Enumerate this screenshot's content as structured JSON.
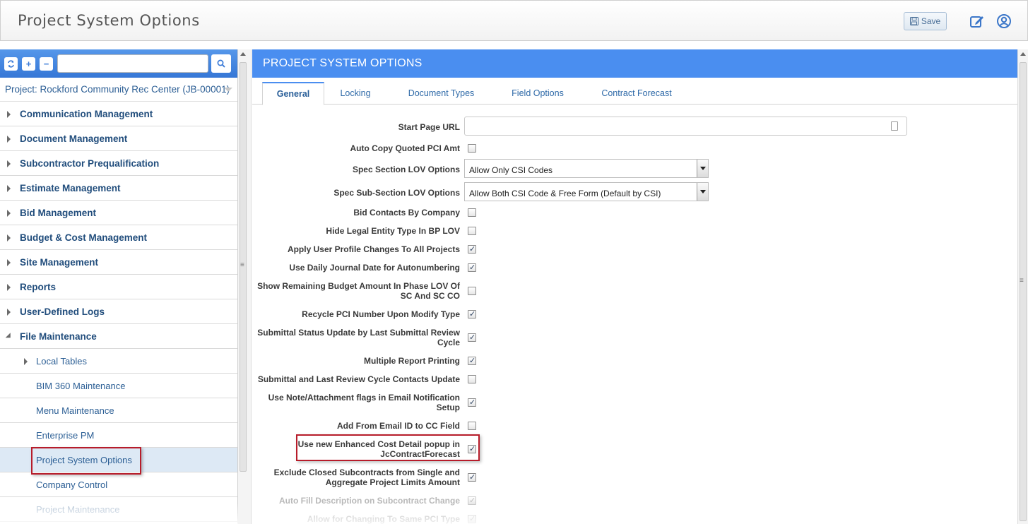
{
  "app": {
    "title": "Project System Options"
  },
  "toolbar": {
    "save_label": "Save"
  },
  "left": {
    "search_placeholder": "",
    "project_label": "Project: Rockford Community Rec Center (JB-00001)",
    "menu": [
      {
        "label": "Communication Management",
        "level": 0,
        "expanded": false
      },
      {
        "label": "Document Management",
        "level": 0,
        "expanded": false
      },
      {
        "label": "Subcontractor Prequalification",
        "level": 0,
        "expanded": false
      },
      {
        "label": "Estimate Management",
        "level": 0,
        "expanded": false
      },
      {
        "label": "Bid Management",
        "level": 0,
        "expanded": false
      },
      {
        "label": "Budget & Cost Management",
        "level": 0,
        "expanded": false
      },
      {
        "label": "Site Management",
        "level": 0,
        "expanded": false
      },
      {
        "label": "Reports",
        "level": 0,
        "expanded": false
      },
      {
        "label": "User-Defined Logs",
        "level": 0,
        "expanded": false
      },
      {
        "label": "File Maintenance",
        "level": 0,
        "expanded": true
      },
      {
        "label": "Local Tables",
        "level": 1,
        "expandable": true
      },
      {
        "label": "BIM 360 Maintenance",
        "level": 1
      },
      {
        "label": "Menu Maintenance",
        "level": 1
      },
      {
        "label": "Enterprise PM",
        "level": 1
      },
      {
        "label": "Project System Options",
        "level": 1,
        "selected": true
      },
      {
        "label": "Company Control",
        "level": 1
      },
      {
        "label": "Project Maintenance",
        "level": 1,
        "faded": true
      }
    ]
  },
  "main": {
    "header": "PROJECT SYSTEM OPTIONS",
    "tabs": [
      {
        "label": "General",
        "active": true
      },
      {
        "label": "Locking"
      },
      {
        "label": "Document Types"
      },
      {
        "label": "Field Options"
      },
      {
        "label": "Contract Forecast"
      }
    ],
    "fields": {
      "start_page_url": {
        "label": "Start Page URL",
        "value": ""
      },
      "auto_copy": {
        "label": "Auto Copy Quoted PCI Amt",
        "checked": false
      },
      "spec_section": {
        "label": "Spec Section LOV Options",
        "value": "Allow Only CSI Codes"
      },
      "spec_sub_section": {
        "label": "Spec Sub-Section LOV Options",
        "value": "Allow Both CSI Code & Free Form (Default by CSI)"
      },
      "bid_contacts": {
        "label": "Bid Contacts By Company",
        "checked": false
      },
      "hide_legal": {
        "label": "Hide Legal Entity Type In BP LOV",
        "checked": false
      },
      "apply_profile": {
        "label": "Apply User Profile Changes To All Projects",
        "checked": true
      },
      "daily_journal": {
        "label": "Use Daily Journal Date for Autonumbering",
        "checked": true
      },
      "remaining_budget": {
        "label": "Show Remaining Budget Amount In Phase LOV Of SC And SC CO",
        "checked": false
      },
      "recycle_pci": {
        "label": "Recycle PCI Number Upon Modify Type",
        "checked": true
      },
      "submittal_status": {
        "label": "Submittal Status Update by Last Submittal Review Cycle",
        "checked": true
      },
      "multiple_report": {
        "label": "Multiple Report Printing",
        "checked": true
      },
      "submittal_contacts": {
        "label": "Submittal and Last Review Cycle Contacts Update",
        "checked": false
      },
      "note_attachment": {
        "label": "Use Note/Attachment flags in Email Notification Setup",
        "checked": true
      },
      "add_from_email": {
        "label": "Add From Email ID to CC Field",
        "checked": false
      },
      "enhanced_cost": {
        "label": "Use new Enhanced Cost Detail popup in JcContractForecast",
        "checked": true
      },
      "exclude_closed": {
        "label": "Exclude Closed Subcontracts from Single and Aggregate Project Limits Amount",
        "checked": true
      },
      "auto_fill": {
        "label": "Auto Fill Description on Subcontract Change",
        "checked": true,
        "disabled": true
      },
      "allow_changing": {
        "label": "Allow for Changing To Same PCI Type",
        "checked": true,
        "disabled": true
      }
    }
  }
}
